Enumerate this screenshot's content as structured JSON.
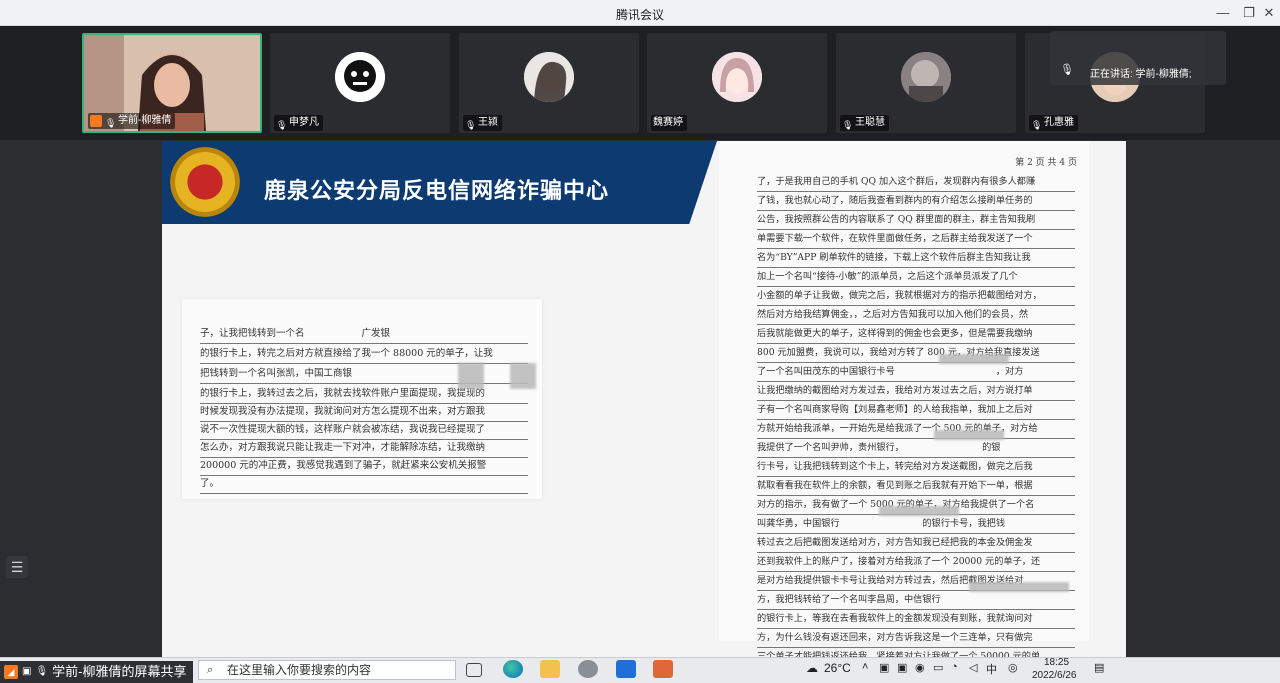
{
  "window": {
    "title": "腾讯会议",
    "min": "—",
    "max": "❐",
    "close": "✕"
  },
  "participants": [
    {
      "name": "学前-柳雅倩",
      "active": true
    },
    {
      "name": "申梦凡"
    },
    {
      "name": "王颍"
    },
    {
      "name": "魏赛婷"
    },
    {
      "name": "王聪慧"
    },
    {
      "name": "孔惠雅"
    }
  ],
  "speaking": {
    "label": "正在讲话: 学前-柳雅倩;"
  },
  "slide": {
    "banner_title": "鹿泉公安分局反电信网络诈骗中心",
    "doc1_lines": [
      "子，让我把钱转到一个名　　　　　　广发银",
      "的银行卡上，转完之后对方就直接给了我一个 88000 元的单子，让我",
      "把钱转到一个名叫张凯，中国工商银",
      "的银行卡上，我转过去之后，我就去找软件账户里面提现，我提现的",
      "时候发现我没有办法提现，我就询问对方怎么提现不出来，对方跟我",
      "说不一次性提现大额的钱，这样账户就会被冻结，我说我已经提现了",
      "怎么办，对方跟我说只能让我走一下对冲，才能解除冻结，让我缴纳",
      "200000 元的冲正费，我感觉我遇到了骗子，就赶紧来公安机关报警",
      "了。"
    ],
    "doc2_page": "第 2 页 共 4 页",
    "doc2_lines": [
      "了，于是我用自己的手机 QQ 加入这个群后，发现群内有很多人都赚",
      "了钱，我也就心动了，随后我查看到群内的有介绍怎么接刷单任务的",
      "公告，我按照群公告的内容联系了 QQ 群里面的群主，群主告知我刷",
      "单需要下载一个软件，在软件里面做任务，之后群主给我发送了一个",
      "名为“BY”APP 刷单软件的链接，下载上这个软件后群主告知我让我",
      "加上一个名叫“接待-小敏”的派单员，之后这个派单员派发了几个",
      "小金额的单子让我做，做完之后，我就根据对方的指示把截图给对方，",
      "然后对方给我结算佣金，，之后对方告知我可以加入他们的会员，然",
      "后我就能做更大的单子，这样得到的佣金也会更多，但是需要我缴纳",
      "800 元加盟费，我说可以，我给对方转了 800 元，对方给我直接发送",
      "了一个名叫田茂东的中国银行卡号　　　　　　　　　　　，对方",
      "让我把缴纳的截图给对方发过去，我给对方发过去之后，对方说打单",
      "子有一个名叫商家导购【刘易鑫老师】的人给我指单，我加上之后对",
      "方就开始给我派单，一开始先是给我派了一个 500 元的单子，对方给",
      "我提供了一个名叫尹帅，贵州银行，　　　　　　　　　的银",
      "行卡号，让我把钱转到这个卡上，转完给对方发送截图，做完之后我",
      "就取看看我在软件上的余额，看见到账之后我就有开始下一单，根据",
      "对方的指示，我有做了一个 5000 元的单子，对方给我提供了一个名",
      "叫龚华勇，中国银行　　　　　　　　　的银行卡号，我把钱",
      "转过去之后把截图发送给对方，对方告知我已经把我的本金及佣金发",
      "还到我软件上的账户了，接着对方给我派了一个 20000 元的单子，还",
      "是对方给我提供银卡卡号让我给对方转过去，然后把截图发送给对",
      "方，我把钱转给了一个名叫李昌周，中信银行　　　　　　　　　",
      "的银行卡上，等我在去看我软件上的金额发现没有到账，我就询问对",
      "方，为什么钱没有返还回来，对方告诉我这是一个三连单，只有做完",
      "三个单子才能把钱返还给我，紧接着对方让我做了一个 50000 元的单"
    ]
  },
  "share_label": "学前-柳雅倩的屏幕共享",
  "taskbar": {
    "search_placeholder": "在这里输入你要搜索的内容",
    "weather": "26°C",
    "time": "18:25",
    "date": "2022/6/26"
  }
}
